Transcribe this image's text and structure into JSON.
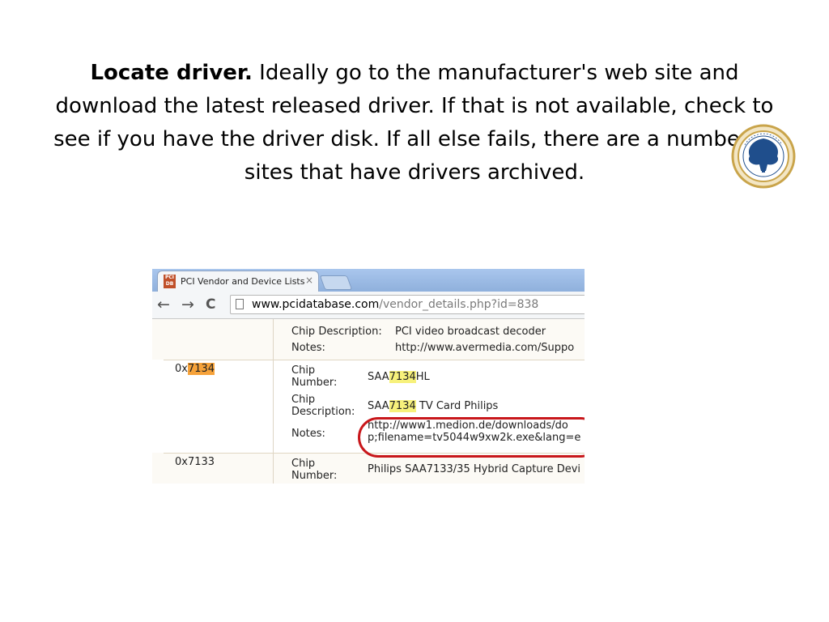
{
  "slide": {
    "heading_bold": "Locate driver.",
    "body_text": " Ideally go to the manufacturer's web site and download the latest released driver. If that is not available, check to see if you have the driver disk. If all else fails, there are a number of sites that have drivers archived.",
    "seal_text": "SRM UNIVERSITY"
  },
  "browser": {
    "tab_favicon_text": "PCI DB",
    "tab_title": "PCI Vendor and Device Lists",
    "tab_close": "×",
    "nav_back": "←",
    "nav_forward": "→",
    "nav_reload": "C",
    "url_host": "www.pcidatabase.com",
    "url_path": "/vendor_details.php?id=838"
  },
  "table": {
    "row0": {
      "desc_label": "Chip Description:",
      "desc_value": "PCI video broadcast decoder",
      "notes_label": "Notes:",
      "notes_value": "http://www.avermedia.com/Suppo"
    },
    "row1": {
      "id_prefix": "0x",
      "id_highlight": "7134",
      "number_label_1": "Chip",
      "number_label_2": "Number:",
      "number_pre": "SAA",
      "number_hl": "7134",
      "number_post": "HL",
      "desc_label_1": "Chip",
      "desc_label_2": "Description:",
      "desc_pre": "SAA",
      "desc_hl": "7134",
      "desc_post": " TV Card Philips",
      "notes_label": "Notes:",
      "notes_line1": "http://www1.medion.de/downloads/do",
      "notes_line2": "p;filename=tv5044w9xw2k.exe&lang=e"
    },
    "row2": {
      "id": "0x7133",
      "number_label_1": "Chip",
      "number_label_2": "Number:",
      "number_value": "Philips SAA7133/35 Hybrid Capture Devi"
    }
  },
  "colors": {
    "highlight_orange": "#f6a23a",
    "highlight_yellow": "#f7f17b",
    "annotation_red": "#c8171b",
    "seal_blue": "#1f4e8c",
    "seal_gold": "#c9a44a"
  }
}
